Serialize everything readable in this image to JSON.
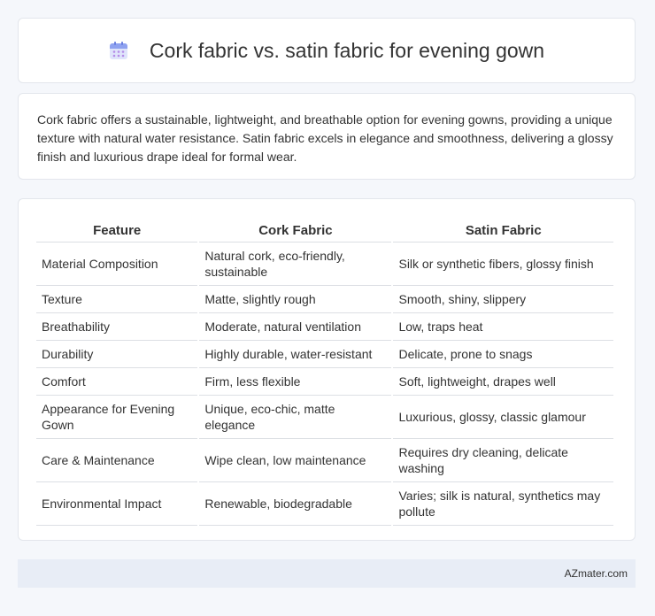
{
  "header": {
    "title": "Cork fabric vs. satin fabric for evening gown",
    "icon": "calendar-icon"
  },
  "intro": {
    "text": "Cork fabric offers a sustainable, lightweight, and breathable option for evening gowns, providing a unique texture with natural water resistance. Satin fabric excels in elegance and smoothness, delivering a glossy finish and luxurious drape ideal for formal wear."
  },
  "table": {
    "headers": [
      "Feature",
      "Cork Fabric",
      "Satin Fabric"
    ],
    "rows": [
      [
        "Material Composition",
        "Natural cork, eco-friendly, sustainable",
        "Silk or synthetic fibers, glossy finish"
      ],
      [
        "Texture",
        "Matte, slightly rough",
        "Smooth, shiny, slippery"
      ],
      [
        "Breathability",
        "Moderate, natural ventilation",
        "Low, traps heat"
      ],
      [
        "Durability",
        "Highly durable, water-resistant",
        "Delicate, prone to snags"
      ],
      [
        "Comfort",
        "Firm, less flexible",
        "Soft, lightweight, drapes well"
      ],
      [
        "Appearance for Evening Gown",
        "Unique, eco-chic, matte elegance",
        "Luxurious, glossy, classic glamour"
      ],
      [
        "Care & Maintenance",
        "Wipe clean, low maintenance",
        "Requires dry cleaning, delicate washing"
      ],
      [
        "Environmental Impact",
        "Renewable, biodegradable",
        "Varies; silk is natural, synthetics may pollute"
      ]
    ]
  },
  "footer": {
    "text": "AZmater.com"
  }
}
